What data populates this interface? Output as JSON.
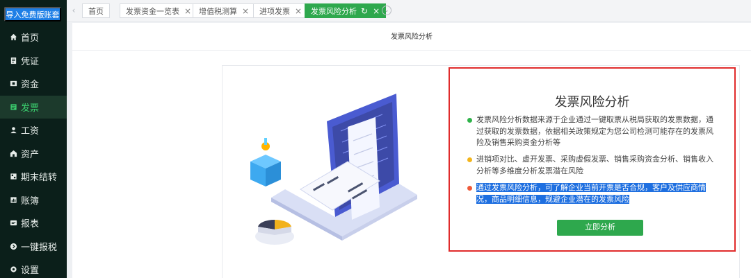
{
  "sidebar": {
    "import_button": "导入免费版账套",
    "items": [
      {
        "label": "首页",
        "icon": "home-icon"
      },
      {
        "label": "凭证",
        "icon": "voucher-icon"
      },
      {
        "label": "资金",
        "icon": "funds-icon"
      },
      {
        "label": "发票",
        "icon": "invoice-icon"
      },
      {
        "label": "工资",
        "icon": "salary-icon"
      },
      {
        "label": "资产",
        "icon": "assets-icon"
      },
      {
        "label": "期末结转",
        "icon": "closing-icon"
      },
      {
        "label": "账簿",
        "icon": "ledger-icon"
      },
      {
        "label": "报表",
        "icon": "report-icon"
      },
      {
        "label": "一键报税",
        "icon": "tax-icon"
      },
      {
        "label": "设置",
        "icon": "settings-icon"
      }
    ],
    "active_item": "发票"
  },
  "tabs": [
    {
      "label": "首页",
      "closable": false
    },
    {
      "label": "发票资金一览表",
      "closable": true
    },
    {
      "label": "增值税测算",
      "closable": true
    },
    {
      "label": "进项发票",
      "closable": true
    },
    {
      "label": "发票风险分析",
      "closable": true,
      "active": true
    }
  ],
  "close_glyph": "×",
  "refresh_glyph": "↻",
  "page_title": "发票风险分析",
  "info": {
    "title": "发票风险分析",
    "bullets": [
      {
        "text": "发票风险分析数据来源于企业通过一键取票从税局获取的发票数据，通过获取的发票数据，依据相关政策规定为您公司检测可能存在的发票风险及销售采购资金分析等",
        "color": "#2fb34a"
      },
      {
        "text": "进销项对比、虚开发票、采购虚假发票、销售采购资金分析、销售收入分析等多维度分析发票潜在风险",
        "color": "#f3b51c"
      },
      {
        "text": "通过发票风险分析，可了解企业当前开票是否合规，客户及供应商情况，商品明细信息，规避企业潜在的发票风险",
        "color": "#ef5a3a",
        "selected": true
      }
    ],
    "action_button": "立即分析"
  },
  "colors": {
    "accent": "#2ea84d",
    "sidebar_bg": "#0b1f1a",
    "import_button": "#1e7fe6",
    "highlight_border": "#e02b2b"
  }
}
